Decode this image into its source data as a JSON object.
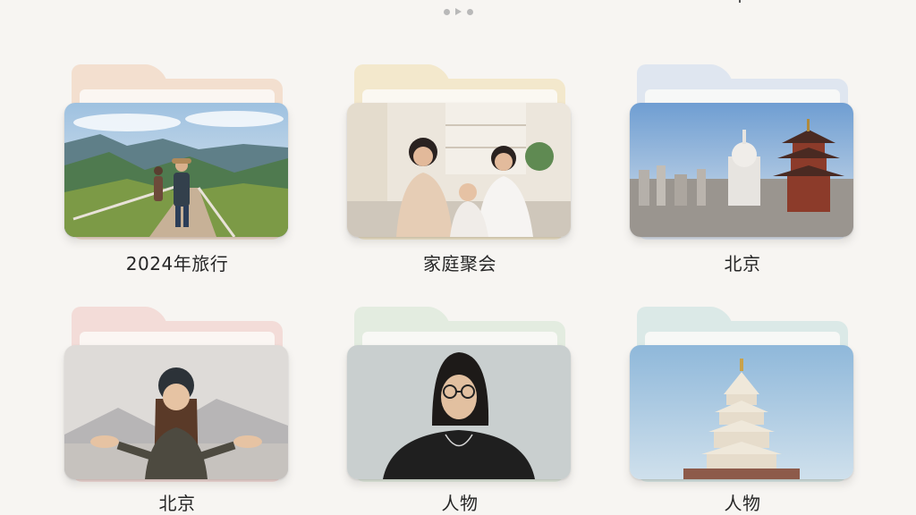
{
  "pager": {
    "pages": 3,
    "active_shape": "play"
  },
  "folders": [
    {
      "label": "2024年旅行",
      "tab_color": "#f3dfcf",
      "photo": "mountain-hikers"
    },
    {
      "label": "家庭聚会",
      "tab_color": "#f3e8cc",
      "photo": "family-portrait"
    },
    {
      "label": "北京",
      "tab_color": "#dfe6f0",
      "photo": "city-skyline-pagoda"
    },
    {
      "label": "北京",
      "tab_color": "#f3dcd8",
      "photo": "woman-beanie"
    },
    {
      "label": "人物",
      "tab_color": "#e3ece0",
      "photo": "man-glasses"
    },
    {
      "label": "人物",
      "tab_color": "#dbe9e7",
      "photo": "white-tower"
    }
  ]
}
